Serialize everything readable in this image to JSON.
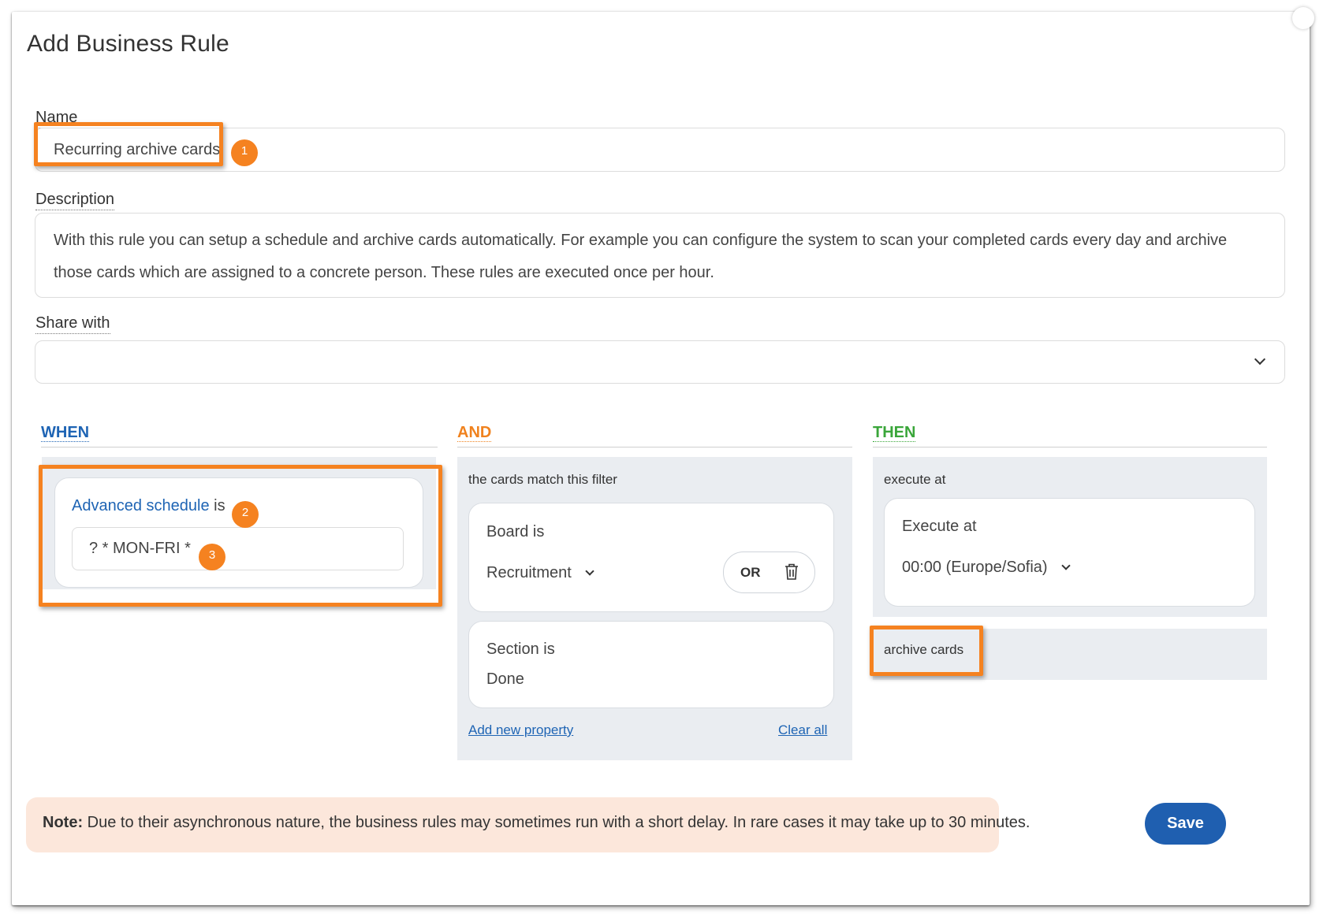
{
  "dialog": {
    "title": "Add Business Rule",
    "name_label": "Name",
    "name_value": "Recurring archive cards",
    "description_label": "Description",
    "description_value": "With this rule you can setup a schedule and archive cards automatically. For example you can configure the system to scan your completed cards every day and archive those cards which are assigned to a concrete person. These rules are executed once per hour.",
    "share_label": "Share with",
    "share_value": ""
  },
  "badges": [
    "1",
    "2",
    "3"
  ],
  "when": {
    "title": "WHEN",
    "condition_link": "Advanced schedule",
    "condition_suffix": "is",
    "schedule_value": "? * MON-FRI *"
  },
  "and": {
    "title": "AND",
    "filter_label": "the cards match this filter",
    "board_label": "Board is",
    "board_value": "Recruitment",
    "or_label": "OR",
    "section_label": "Section is",
    "section_value": "Done",
    "add_property": "Add new property",
    "clear_all": "Clear all"
  },
  "then": {
    "title": "THEN",
    "execute_label": "execute at",
    "execute_card_label": "Execute at",
    "execute_value": "00:00 (Europe/Sofia)",
    "action_label": "archive cards"
  },
  "note": {
    "prefix": "Note:",
    "text": "Due to their asynchronous nature, the business rules may sometimes run with a short delay. In rare cases it may take up to 30 minutes."
  },
  "save_label": "Save",
  "colors": {
    "when": "#1e64b4",
    "and": "#f0821e",
    "then": "#3aa63a",
    "highlight": "#f58220",
    "save": "#1f5fb0",
    "note_bg": "#fce7db"
  }
}
